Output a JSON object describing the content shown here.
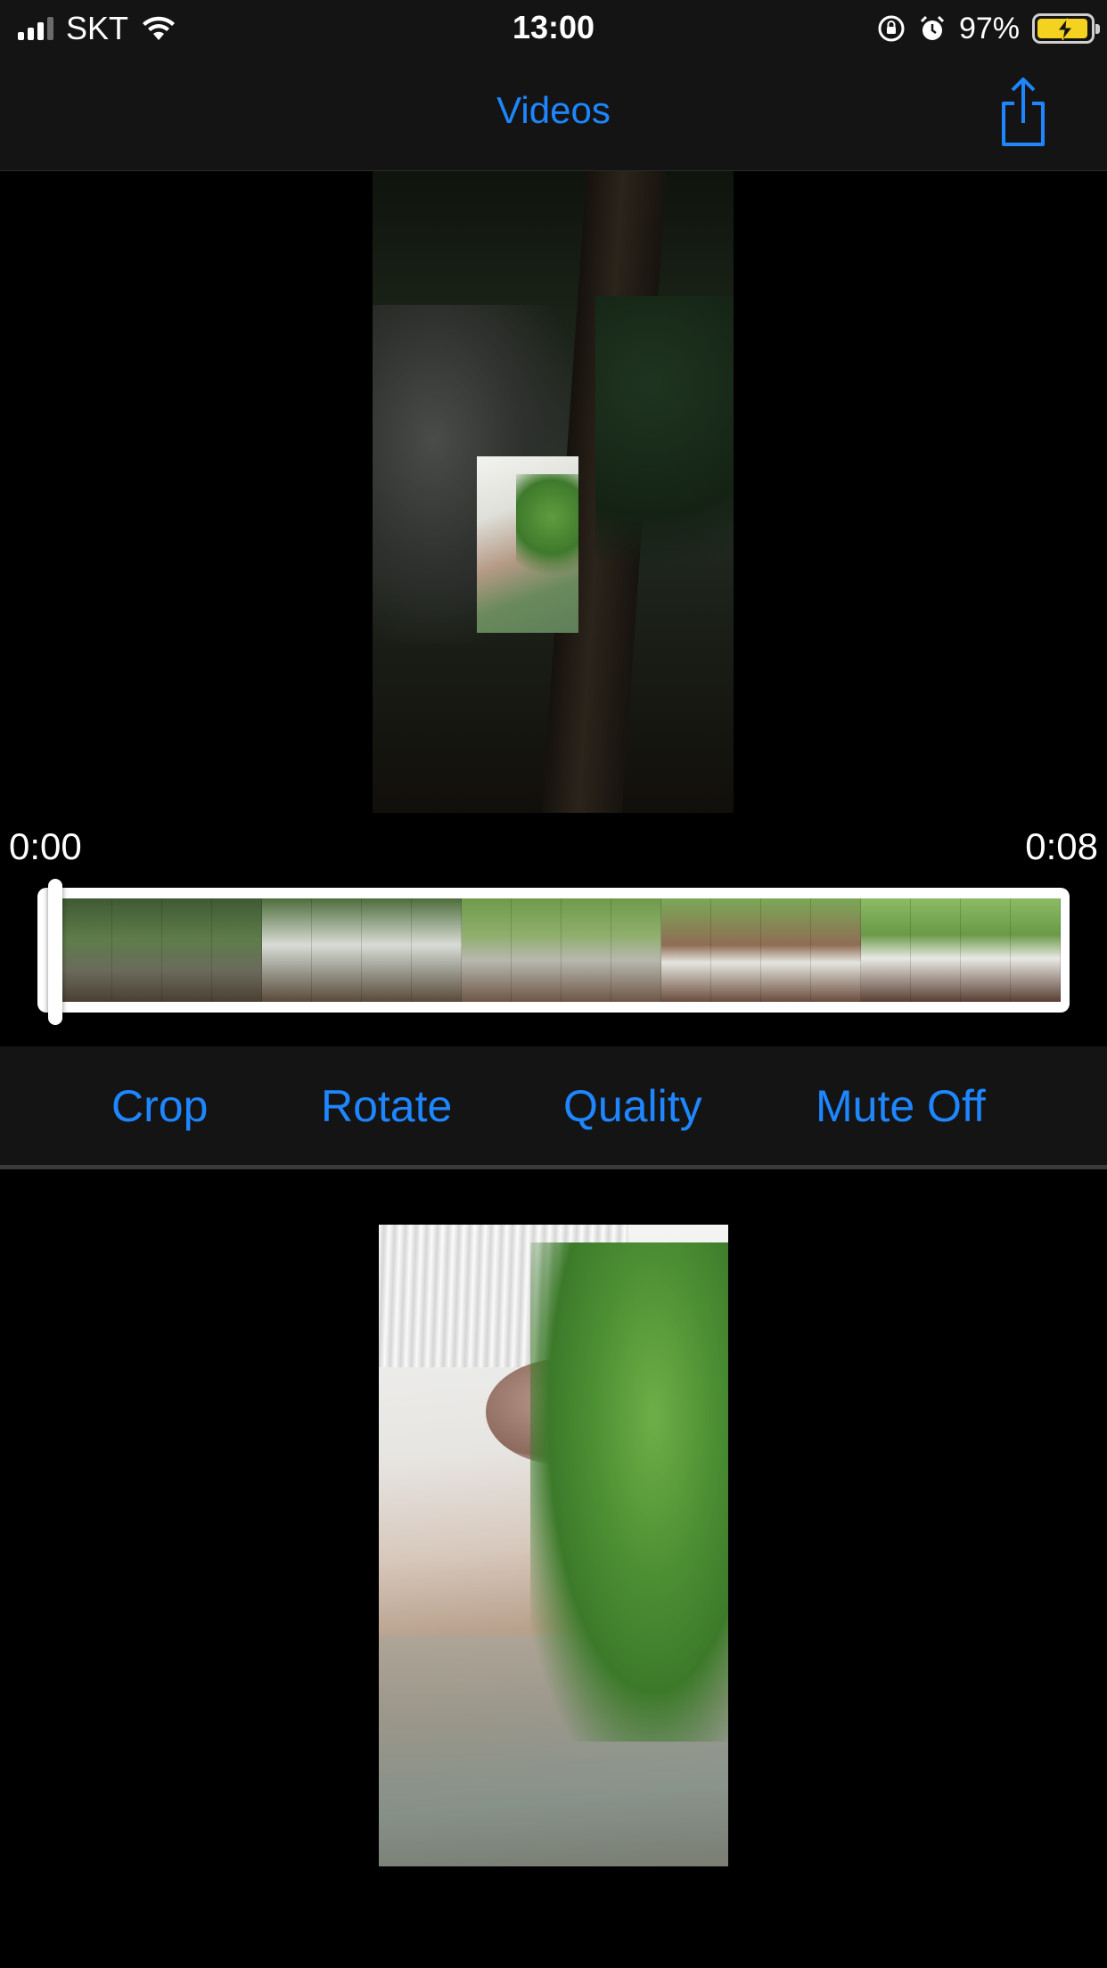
{
  "status_bar": {
    "carrier": "SKT",
    "time": "13:00",
    "battery_percent": "97%",
    "battery_level": 0.97,
    "battery_color": "#f4d21f",
    "icons": [
      "cellular-signal-icon",
      "wifi-icon",
      "orientation-lock-icon",
      "alarm-icon",
      "battery-charging-icon"
    ]
  },
  "nav": {
    "title": "Videos",
    "share_icon": "share-icon"
  },
  "accent_color": "#1e86ff",
  "timeline": {
    "start_time": "0:00",
    "end_time": "0:08",
    "playhead_position": 0.0,
    "frame_count": 20
  },
  "toolbar": {
    "crop_label": "Crop",
    "rotate_label": "Rotate",
    "quality_label": "Quality",
    "mute_label": "Mute Off"
  }
}
